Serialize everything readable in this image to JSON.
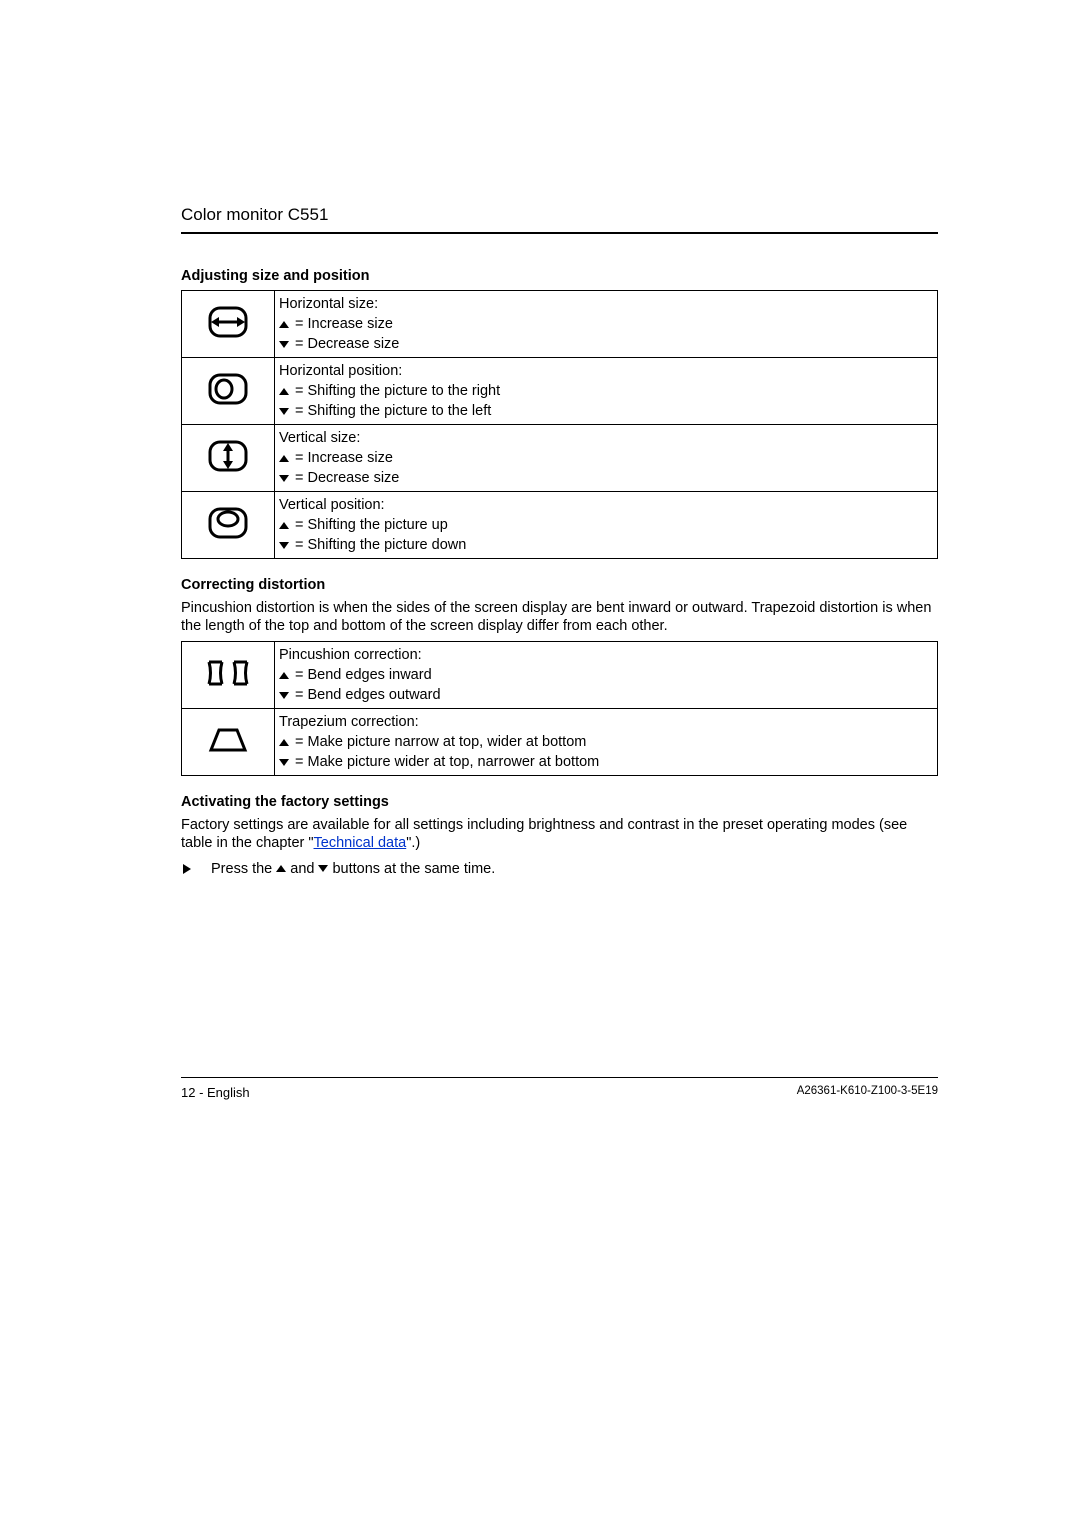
{
  "header": {
    "title": "Color monitor C551"
  },
  "section1": {
    "title": "Adjusting size and position",
    "rows": [
      {
        "icon": "horizontal-size-icon",
        "heading": "Horizontal size:",
        "up_text": "= Increase size",
        "down_text": "= Decrease size"
      },
      {
        "icon": "horizontal-position-icon",
        "heading": "Horizontal position:",
        "up_text": "= Shifting the picture to the right",
        "down_text": "= Shifting the picture to the left"
      },
      {
        "icon": "vertical-size-icon",
        "heading": "Vertical size:",
        "up_text": "= Increase size",
        "down_text": "= Decrease size"
      },
      {
        "icon": "vertical-position-icon",
        "heading": "Vertical position:",
        "up_text": "= Shifting the picture up",
        "down_text": "= Shifting the picture down"
      }
    ]
  },
  "section2": {
    "title": "Correcting distortion",
    "intro": "Pincushion distortion is when the sides of the screen display are bent inward or outward. Trapezoid distortion is when the length of the top and bottom of the screen display differ from each other.",
    "rows": [
      {
        "icon": "pincushion-icon",
        "heading": "Pincushion correction:",
        "up_text": "= Bend edges inward",
        "down_text": "= Bend edges outward"
      },
      {
        "icon": "trapezium-icon",
        "heading": "Trapezium correction:",
        "up_text": "= Make picture narrow at top, wider at bottom",
        "down_text": "= Make picture wider at top, narrower at bottom"
      }
    ]
  },
  "section3": {
    "title": "Activating the factory settings",
    "intro_pre": "Factory settings are available for all settings including brightness and contrast in the preset operating modes (see table in the chapter \"",
    "link_text": "Technical data",
    "intro_post": "\".)",
    "bullet_pre": "Press the",
    "bullet_mid": "and",
    "bullet_post": "buttons at the same time."
  },
  "footer": {
    "left": "12 - English",
    "right": "A26361-K610-Z100-3-5E19"
  }
}
